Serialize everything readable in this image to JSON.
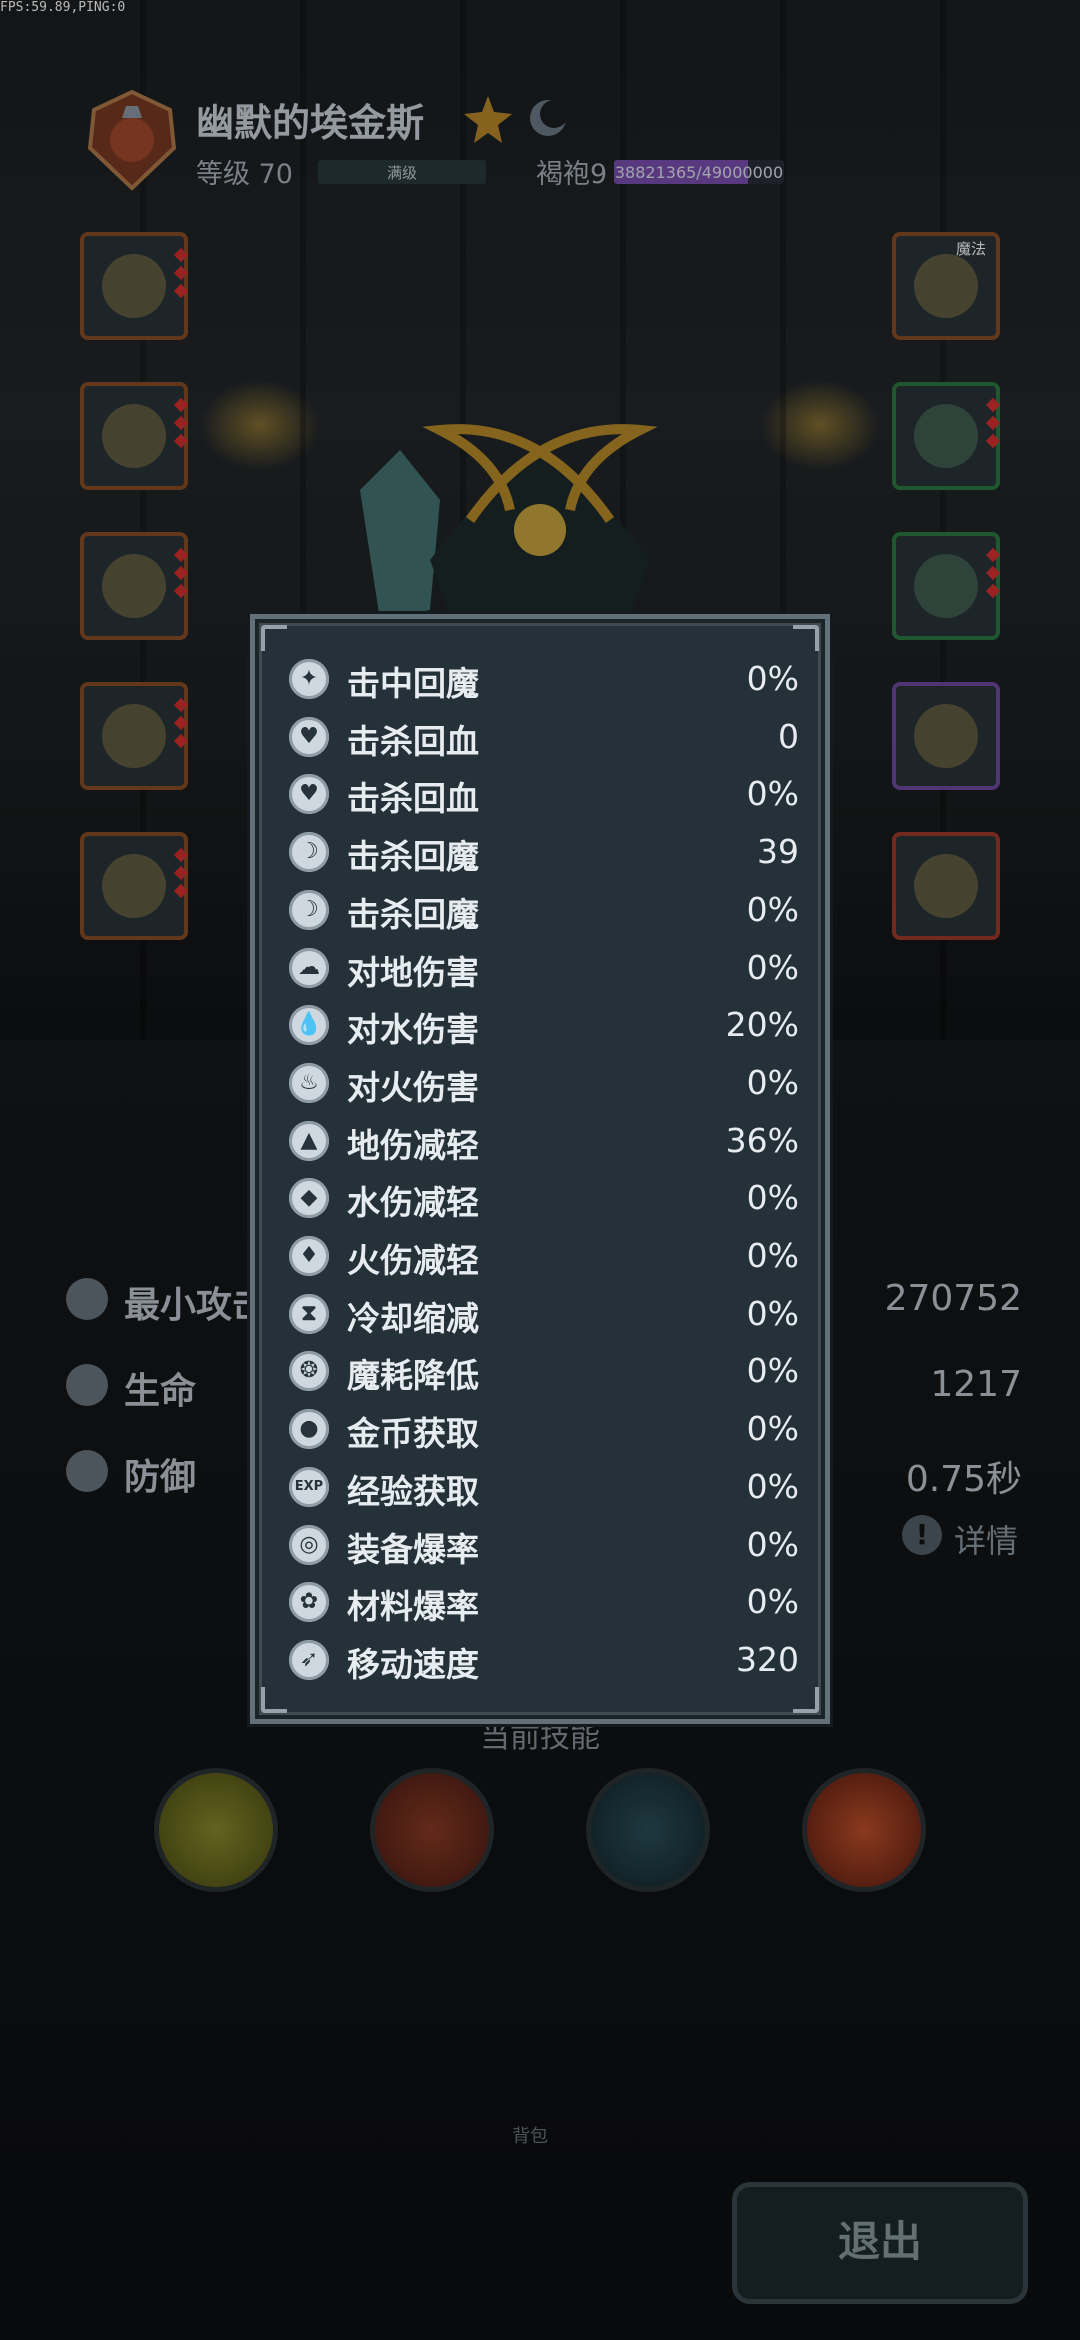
{
  "hud": {
    "fps": "FPS:59.89,PING:0"
  },
  "hero": {
    "name": "幽默的埃金斯",
    "level": "等级 70",
    "level_status": "满级",
    "armor": "褐袍9",
    "exp_current": "38821365",
    "exp_max": "49000000",
    "exp_fraction": 0.79
  },
  "equipment": {
    "magic_tag": "魔法"
  },
  "background_stats": [
    {
      "icon": "sword-icon",
      "label": "最小攻击",
      "value": "270752"
    },
    {
      "icon": "heart-icon",
      "label": "生命",
      "value": "1217"
    },
    {
      "icon": "shield-icon",
      "label": "防御",
      "value": "0.75秒"
    }
  ],
  "detail": {
    "icon": "!",
    "label": "详情"
  },
  "current_skill_label": "当前技能",
  "misc_small_label": "背包",
  "exit_button_label": "退出",
  "stats_panel": {
    "rows": [
      {
        "icon": "mana-hit-icon",
        "glyph": "✦",
        "label": "击中回魔",
        "value": "0%"
      },
      {
        "icon": "heart-kill-icon",
        "glyph": "♥",
        "label": "击杀回血",
        "value": "0"
      },
      {
        "icon": "heart-kill-pct-icon",
        "glyph": "♥",
        "label": "击杀回血",
        "value": "0%"
      },
      {
        "icon": "mana-kill-icon",
        "glyph": "☽",
        "label": "击杀回魔",
        "value": "39"
      },
      {
        "icon": "mana-kill-pct-icon",
        "glyph": "☽",
        "label": "击杀回魔",
        "value": "0%"
      },
      {
        "icon": "earth-damage-icon",
        "glyph": "☁",
        "label": "对地伤害",
        "value": "0%"
      },
      {
        "icon": "water-damage-icon",
        "glyph": "💧",
        "label": "对水伤害",
        "value": "20%"
      },
      {
        "icon": "fire-damage-icon",
        "glyph": "♨",
        "label": "对火伤害",
        "value": "0%"
      },
      {
        "icon": "earth-resist-icon",
        "glyph": "▲",
        "label": "地伤减轻",
        "value": "36%"
      },
      {
        "icon": "water-resist-icon",
        "glyph": "◆",
        "label": "水伤减轻",
        "value": "0%"
      },
      {
        "icon": "fire-resist-icon",
        "glyph": "♦",
        "label": "火伤减轻",
        "value": "0%"
      },
      {
        "icon": "hourglass-icon",
        "glyph": "⧗",
        "label": "冷却缩减",
        "value": "0%"
      },
      {
        "icon": "mana-cost-icon",
        "glyph": "❂",
        "label": "魔耗降低",
        "value": "0%"
      },
      {
        "icon": "coin-icon",
        "glyph": "●",
        "label": "金币获取",
        "value": "0%"
      },
      {
        "icon": "exp-icon",
        "glyph": "EXP",
        "label": "经验获取",
        "value": "0%"
      },
      {
        "icon": "equipment-drop-icon",
        "glyph": "◎",
        "label": "装备爆率",
        "value": "0%"
      },
      {
        "icon": "material-drop-icon",
        "glyph": "✿",
        "label": "材料爆率",
        "value": "0%"
      },
      {
        "icon": "boot-icon",
        "glyph": "➶",
        "label": "移动速度",
        "value": "320"
      }
    ]
  }
}
